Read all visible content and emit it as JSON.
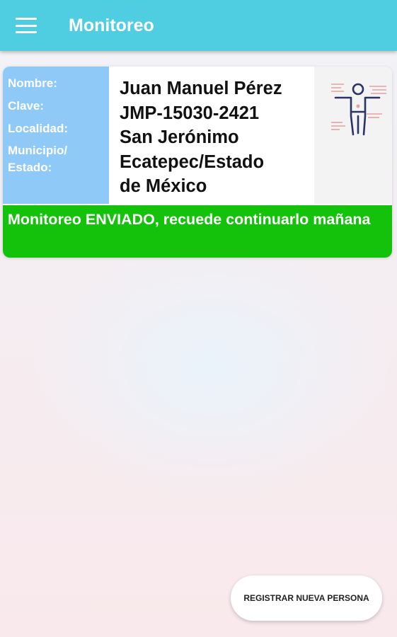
{
  "appbar": {
    "title": "Monitoreo",
    "menu_icon": "hamburger-menu-icon"
  },
  "card": {
    "labels": {
      "nombre": "Nombre:",
      "clave": "Clave:",
      "localidad": "Localidad:",
      "municipio": "Municipio/",
      "estado": "Estado:"
    },
    "values": [
      "Juan Manuel Pérez",
      "JMP-15030-2421",
      "San Jerónimo",
      "Ecatepec/Estado",
      "de México"
    ],
    "image_icon": "body-scan-person-icon",
    "status": "Monitoreo ENVIADO, recuede continuarlo mañana"
  },
  "fab": {
    "label": "REGISTRAR NUEVA PERSONA"
  },
  "colors": {
    "appbar": "#4fcde1",
    "labels_bg": "#8fc9f8",
    "status_bg": "#14c20c"
  }
}
